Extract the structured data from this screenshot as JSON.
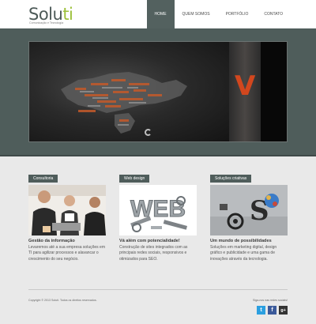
{
  "header": {
    "logo_part1": "Solu",
    "logo_part2": "ti",
    "tagline": "Comunicação e Tecnologia",
    "nav": [
      {
        "label": "Home",
        "active": true
      },
      {
        "label": "Quem somos",
        "active": false
      },
      {
        "label": "Portfólio",
        "active": false
      },
      {
        "label": "Contato",
        "active": false
      }
    ]
  },
  "hero": {
    "slide_letter": "V"
  },
  "features": [
    {
      "tag": "Consultoria",
      "title": "Gestão da informação",
      "text": "Levaremos até a sua empresa soluções em TI para agilizar processos e alavancar o crescimento do seu negócio."
    },
    {
      "tag": "Web design",
      "image_text": "WEB",
      "title": "Vá além com potencialidade!",
      "text": "Construção de sites integrados com as principais redes sociais, responsivos e otimizados para SEO."
    },
    {
      "tag": "Soluções criativas",
      "title": "Um mundo de possibilidades",
      "text": "Soluções em marketing digital, design gráfico e publicidade e uma gama de inovações através da tecnologia."
    }
  ],
  "footer": {
    "copyright": "Copyright © 2013 Soluti. Todos os direitos reservados.",
    "social_label": "Siga-nos nas redes sociais!",
    "social": [
      {
        "icon": "twitter-icon",
        "glyph": "t",
        "color": "#2b9fe0"
      },
      {
        "icon": "facebook-icon",
        "glyph": "f",
        "color": "#3b5a9a"
      },
      {
        "icon": "google-plus-icon",
        "glyph": "g+",
        "color": "#333333"
      }
    ]
  },
  "colors": {
    "primary": "#4f5d5b",
    "accent": "#9cc03a",
    "background": "#e9e9e9"
  }
}
